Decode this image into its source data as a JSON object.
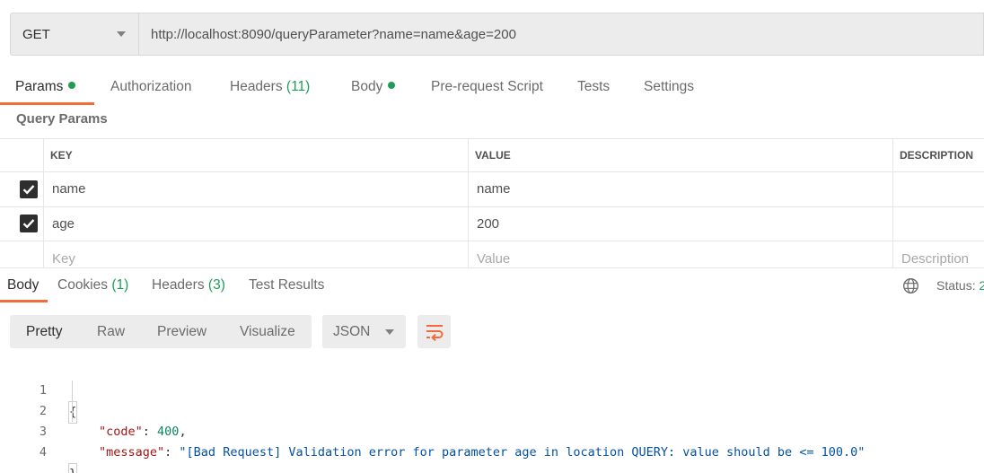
{
  "request": {
    "method": "GET",
    "url": "http://localhost:8090/queryParameter?name=name&age=200"
  },
  "request_tabs": [
    {
      "label": "Params",
      "dot": true,
      "active": true
    },
    {
      "label": "Authorization"
    },
    {
      "label": "Headers",
      "count": "(11)"
    },
    {
      "label": "Body",
      "dot": true
    },
    {
      "label": "Pre-request Script"
    },
    {
      "label": "Tests"
    },
    {
      "label": "Settings"
    }
  ],
  "query_params": {
    "title": "Query Params",
    "headers": {
      "key": "KEY",
      "value": "VALUE",
      "description": "DESCRIPTION"
    },
    "rows": [
      {
        "checked": true,
        "key": "name",
        "value": "name",
        "description": ""
      },
      {
        "checked": true,
        "key": "age",
        "value": "200",
        "description": ""
      }
    ],
    "placeholders": {
      "key": "Key",
      "value": "Value",
      "description": "Description"
    }
  },
  "response_tabs": [
    {
      "label": "Body",
      "active": true
    },
    {
      "label": "Cookies",
      "count": "(1)"
    },
    {
      "label": "Headers",
      "count": "(3)"
    },
    {
      "label": "Test Results"
    }
  ],
  "status_label": "Status:",
  "status_value": "2",
  "view_modes": [
    "Pretty",
    "Raw",
    "Preview",
    "Visualize"
  ],
  "active_view": "Pretty",
  "format": "JSON",
  "code_lines": {
    "l1": {
      "num": "1",
      "text": "{"
    },
    "l2": {
      "num": "2",
      "key": "\"code\"",
      "sep": ": ",
      "val": "400",
      "end": ","
    },
    "l3": {
      "num": "3",
      "key": "\"message\"",
      "sep": ": ",
      "val": "\"[Bad Request] Validation error for parameter age in location QUERY: value should be <= 100.0\""
    },
    "l4": {
      "num": "4",
      "text": "}"
    }
  },
  "colors": {
    "accent": "#f26b3a",
    "success": "#1f9d55"
  }
}
